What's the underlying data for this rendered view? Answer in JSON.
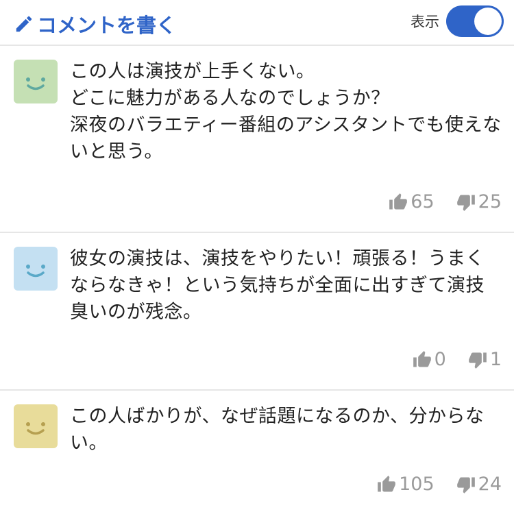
{
  "header": {
    "write_label": "コメントを書く",
    "toggle_label": "表示",
    "toggle_on": true
  },
  "comments": [
    {
      "avatar_color": "#c5e0b4",
      "face_color": "#5fa9a0",
      "text": "この人は演技が上手くない。\nどこに魅力がある人なのでしょうか？\n深夜のバラエティー番組のアシスタントでも使えないと思う。",
      "likes": "65",
      "dislikes": "25"
    },
    {
      "avatar_color": "#c4e0f2",
      "face_color": "#5aa9c8",
      "text": "彼女の演技は、演技をやりたい！頑張る！うまくならなきゃ！という気持ちが全面に出すぎて演技臭いのが残念。",
      "likes": "0",
      "dislikes": "1"
    },
    {
      "avatar_color": "#e8dc9a",
      "face_color": "#b6a050",
      "text": "この人ばかりが、なぜ話題になるのか、分からない。",
      "likes": "105",
      "dislikes": "24"
    }
  ]
}
